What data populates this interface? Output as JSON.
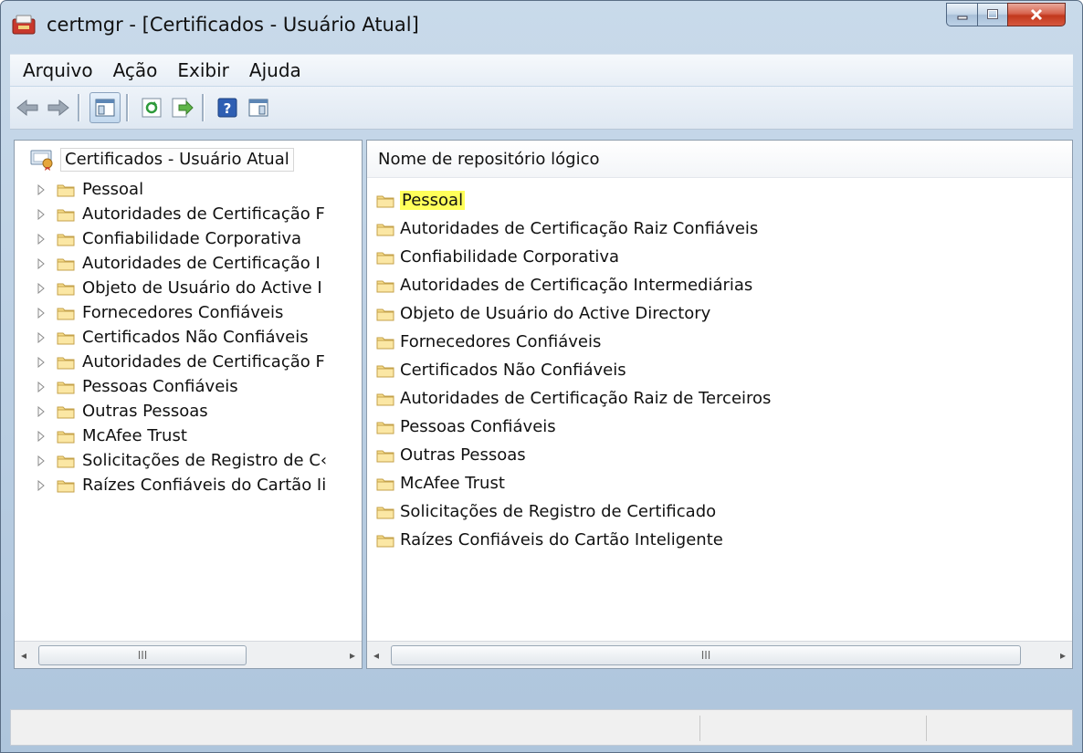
{
  "window": {
    "title": "certmgr - [Certificados - Usuário Atual]",
    "icons": [
      "app-icon",
      "minimize-icon",
      "maximize-icon",
      "close-icon"
    ]
  },
  "menu": {
    "items": [
      "Arquivo",
      "Ação",
      "Exibir",
      "Ajuda"
    ]
  },
  "toolbar": {
    "icons": [
      "back-arrow-icon",
      "forward-arrow-icon",
      "show-hide-console-tree-icon",
      "refresh-icon",
      "export-list-icon",
      "help-icon",
      "action-pane-icon"
    ]
  },
  "tree": {
    "root": "Certificados - Usuário Atual",
    "items": [
      "Pessoal",
      "Autoridades de Certificação F",
      "Confiabilidade Corporativa",
      "Autoridades de Certificação I",
      "Objeto de Usuário do Active I",
      "Fornecedores Confiáveis",
      "Certificados Não Confiáveis",
      "Autoridades de Certificação F",
      "Pessoas Confiáveis",
      "Outras Pessoas",
      "McAfee Trust",
      "Solicitações de Registro de C‹",
      "Raízes Confiáveis do Cartão Ii"
    ]
  },
  "list": {
    "column_header": "Nome de repositório lógico",
    "selected_index": 0,
    "highlight_color": "#ffff5a",
    "items": [
      "Pessoal",
      "Autoridades de Certificação Raiz Confiáveis",
      "Confiabilidade Corporativa",
      "Autoridades de Certificação Intermediárias",
      "Objeto de Usuário do Active Directory",
      "Fornecedores Confiáveis",
      "Certificados Não Confiáveis",
      "Autoridades de Certificação Raiz de Terceiros",
      "Pessoas Confiáveis",
      "Outras Pessoas",
      "McAfee Trust",
      "Solicitações de Registro de Certificado",
      "Raízes Confiáveis do Cartão Inteligente"
    ]
  },
  "scrollbar": {
    "thumb_glyph": "III",
    "left_arrow": "◂",
    "right_arrow": "▸"
  }
}
